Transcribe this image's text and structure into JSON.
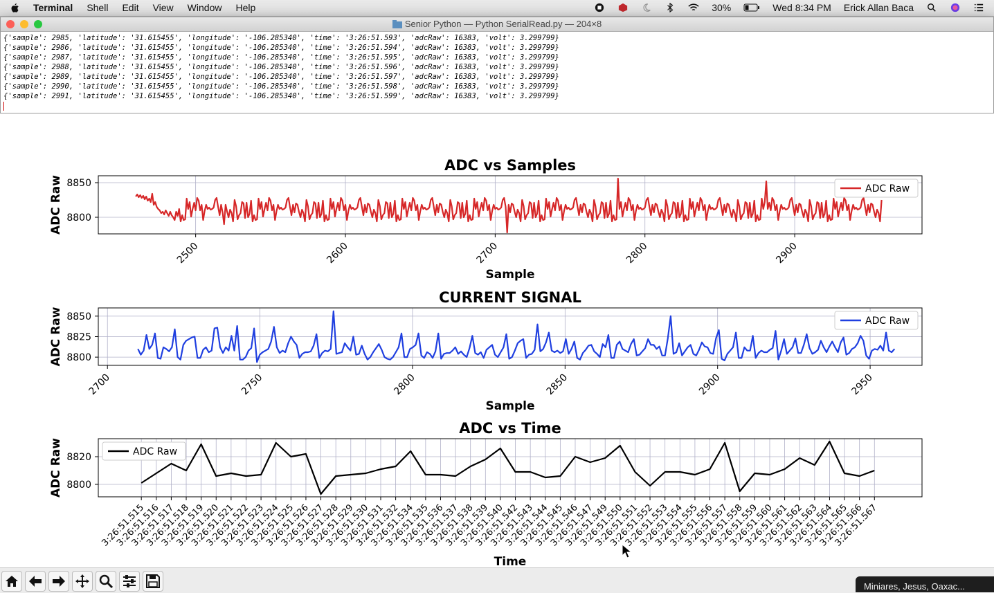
{
  "menubar": {
    "app": "Terminal",
    "items": [
      "Shell",
      "Edit",
      "View",
      "Window",
      "Help"
    ],
    "battery": "30%",
    "clock": "Wed 8:34 PM",
    "user": "Erick Allan Baca"
  },
  "terminal": {
    "title": "Senior Python — Python SerialRead.py — 204×8",
    "lines": [
      "{'sample': 2985, 'latitude': '31.615455', 'longitude': '-106.285340', 'time': '3:26:51.593', 'adcRaw': 16383, 'volt': 3.299799}",
      "{'sample': 2986, 'latitude': '31.615455', 'longitude': '-106.285340', 'time': '3:26:51.594', 'adcRaw': 16383, 'volt': 3.299799}",
      "{'sample': 2987, 'latitude': '31.615455', 'longitude': '-106.285340', 'time': '3:26:51.595', 'adcRaw': 16383, 'volt': 3.299799}",
      "{'sample': 2988, 'latitude': '31.615455', 'longitude': '-106.285340', 'time': '3:26:51.596', 'adcRaw': 16383, 'volt': 3.299799}",
      "{'sample': 2989, 'latitude': '31.615455', 'longitude': '-106.285340', 'time': '3:26:51.597', 'adcRaw': 16383, 'volt': 3.299799}",
      "{'sample': 2990, 'latitude': '31.615455', 'longitude': '-106.285340', 'time': '3:26:51.598', 'adcRaw': 16383, 'volt': 3.299799}",
      "{'sample': 2991, 'latitude': '31.615455', 'longitude': '-106.285340', 'time': '3:26:51.599', 'adcRaw': 16383, 'volt': 3.299799}"
    ]
  },
  "notification": "Miniares, Jesus, Oaxac...",
  "chart_data": [
    {
      "type": "line",
      "title": "ADC vs Samples",
      "xlabel": "Sample",
      "ylabel": "ADC Raw",
      "xlim": [
        2435,
        2985
      ],
      "ylim": [
        8776,
        8860
      ],
      "xticks": [
        2500,
        2600,
        2700,
        2800,
        2900
      ],
      "yticks": [
        8800,
        8850
      ],
      "grid": true,
      "legend_position": "top-right",
      "series": [
        {
          "name": "ADC Raw",
          "color": "#d62728",
          "x_start": 2460,
          "x_end": 2958,
          "pattern": [
            8812,
            8806,
            8818,
            8803,
            8825,
            8810,
            8800,
            8814,
            8822,
            8807,
            8796,
            8816,
            8828,
            8805,
            8811,
            8801,
            8820,
            8809,
            8797,
            8815,
            8824,
            8806,
            8812,
            8799,
            8818,
            8827,
            8803,
            8810,
            8794,
            8814,
            8821,
            8808
          ],
          "values_head": [
            8830,
            8833,
            8829,
            8832,
            8828,
            8831,
            8826,
            8830,
            8824,
            8827,
            8822,
            8834,
            8818,
            8822,
            8815,
            8812,
            8810,
            8806,
            8808,
            8804,
            8810,
            8806,
            8802,
            8808,
            8803,
            8800,
            8796,
            8808,
            8802,
            8812
          ],
          "spikes": [
            {
              "x": 2782,
              "y": 8856
            },
            {
              "x": 2881,
              "y": 8852
            },
            {
              "x": 2708,
              "y": 8778
            },
            {
              "x": 2519,
              "y": 8790
            }
          ]
        }
      ]
    },
    {
      "type": "line",
      "title": "CURRENT SIGNAL",
      "xlabel": "Sample",
      "ylabel": "ADC Raw",
      "xlim": [
        2697,
        2967
      ],
      "ylim": [
        8790,
        8860
      ],
      "xticks": [
        2700,
        2750,
        2800,
        2850,
        2900,
        2950
      ],
      "yticks": [
        8800,
        8825,
        8850
      ],
      "grid": true,
      "legend_position": "top-right",
      "series": [
        {
          "name": "ADC Raw",
          "color": "#1f3fe0",
          "x_start": 2710,
          "x_end": 2958,
          "values": [
            8810,
            8803,
            8808,
            8827,
            8810,
            8815,
            8829,
            8799,
            8798,
            8812,
            8810,
            8807,
            8812,
            8834,
            8800,
            8797,
            8815,
            8820,
            8822,
            8824,
            8825,
            8799,
            8799,
            8809,
            8812,
            8806,
            8808,
            8835,
            8836,
            8812,
            8805,
            8812,
            8808,
            8826,
            8808,
            8838,
            8797,
            8797,
            8800,
            8808,
            8811,
            8835,
            8794,
            8803,
            8806,
            8808,
            8810,
            8819,
            8837,
            8812,
            8805,
            8808,
            8806,
            8817,
            8825,
            8819,
            8815,
            8799,
            8804,
            8806,
            8806,
            8807,
            8814,
            8828,
            8799,
            8805,
            8808,
            8807,
            8810,
            8856,
            8804,
            8805,
            8806,
            8817,
            8812,
            8808,
            8825,
            8803,
            8804,
            8814,
            8804,
            8797,
            8800,
            8806,
            8811,
            8816,
            8809,
            8800,
            8798,
            8797,
            8800,
            8806,
            8812,
            8829,
            8800,
            8800,
            8810,
            8812,
            8815,
            8829,
            8802,
            8799,
            8806,
            8804,
            8799,
            8807,
            8829,
            8798,
            8804,
            8805,
            8805,
            8808,
            8812,
            8804,
            8807,
            8803,
            8800,
            8811,
            8826,
            8805,
            8803,
            8806,
            8799,
            8809,
            8812,
            8815,
            8803,
            8800,
            8806,
            8812,
            8828,
            8798,
            8800,
            8808,
            8817,
            8820,
            8822,
            8799,
            8803,
            8804,
            8809,
            8840,
            8807,
            8810,
            8818,
            8830,
            8808,
            8806,
            8808,
            8805,
            8807,
            8822,
            8804,
            8810,
            8819,
            8799,
            8797,
            8805,
            8809,
            8814,
            8815,
            8807,
            8804,
            8800,
            8816,
            8812,
            8827,
            8799,
            8799,
            8815,
            8819,
            8810,
            8808,
            8806,
            8816,
            8822,
            8802,
            8803,
            8807,
            8811,
            8822,
            8815,
            8815,
            8810,
            8813,
            8802,
            8802,
            8823,
            8850,
            8804,
            8806,
            8817,
            8802,
            8807,
            8812,
            8815,
            8804,
            8802,
            8809,
            8818,
            8813,
            8812,
            8805,
            8804,
            8823,
            8833,
            8798,
            8796,
            8804,
            8808,
            8812,
            8830,
            8799,
            8799,
            8812,
            8808,
            8808,
            8826,
            8799,
            8805,
            8808,
            8806,
            8806,
            8809,
            8811,
            8832,
            8797,
            8808,
            8822,
            8804,
            8808,
            8812,
            8823,
            8805,
            8805,
            8815,
            8828,
            8811,
            8804,
            8806,
            8809,
            8820,
            8812,
            8806,
            8813,
            8819,
            8812,
            8806,
            8818,
            8824,
            8803,
            8805,
            8810,
            8812,
            8817,
            8826,
            8820,
            8802,
            8798,
            8808,
            8810,
            8809,
            8814,
            8808,
            8830,
            8808,
            8806,
            8810
          ]
        }
      ]
    },
    {
      "type": "line",
      "title": "ADC vs Time",
      "xlabel": "Time",
      "ylabel": "ADC Raw",
      "ylim": [
        8791,
        8833
      ],
      "yticks": [
        8800,
        8820
      ],
      "grid": true,
      "legend_position": "top-left",
      "categories": [
        "3:26:51.515",
        "3:26:51.516",
        "3:26:51.517",
        "3:26:51.518",
        "3:26:51.519",
        "3:26:51.520",
        "3:26:51.521",
        "3:26:51.522",
        "3:26:51.523",
        "3:26:51.524",
        "3:26:51.525",
        "3:26:51.526",
        "3:26:51.527",
        "3:26:51.528",
        "3:26:51.529",
        "3:26:51.530",
        "3:26:51.531",
        "3:26:51.532",
        "3:26:51.534",
        "3:26:51.535",
        "3:26:51.536",
        "3:26:51.537",
        "3:26:51.538",
        "3:26:51.539",
        "3:26:51.540",
        "3:26:51.542",
        "3:26:51.543",
        "3:26:51.544",
        "3:26:51.545",
        "3:26:51.546",
        "3:26:51.547",
        "3:26:51.549",
        "3:26:51.550",
        "3:26:51.551",
        "3:26:51.552",
        "3:26:51.553",
        "3:26:51.554",
        "3:26:51.555",
        "3:26:51.556",
        "3:26:51.557",
        "3:26:51.558",
        "3:26:51.559",
        "3:26:51.560",
        "3:26:51.561",
        "3:26:51.562",
        "3:26:51.563",
        "3:26:51.564",
        "3:26:51.565",
        "3:26:51.566",
        "3:26:51.567"
      ],
      "series": [
        {
          "name": "ADC Raw",
          "color": "#000000",
          "values": [
            8801,
            8808,
            8815,
            8810,
            8829,
            8806,
            8808,
            8806,
            8807,
            8830,
            8820,
            8822,
            8793,
            8806,
            8807,
            8808,
            8811,
            8813,
            8824,
            8807,
            8807,
            8806,
            8813,
            8818,
            8826,
            8809,
            8809,
            8805,
            8806,
            8820,
            8816,
            8819,
            8828,
            8809,
            8799,
            8809,
            8809,
            8807,
            8811,
            8830,
            8795,
            8808,
            8807,
            8811,
            8819,
            8814,
            8831,
            8808,
            8806,
            8810
          ]
        }
      ]
    }
  ]
}
